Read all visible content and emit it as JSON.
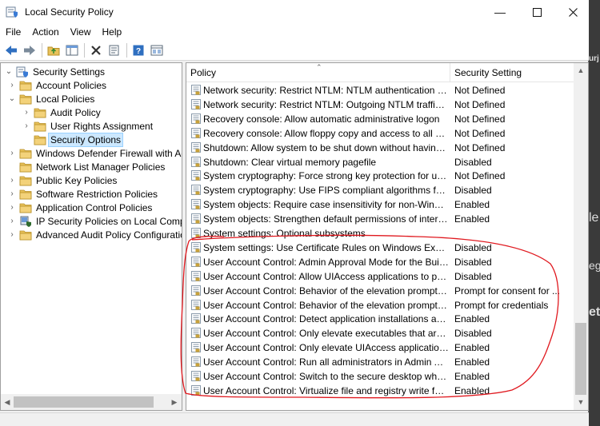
{
  "window": {
    "title": "Local Security Policy"
  },
  "menu": [
    "File",
    "Action",
    "View",
    "Help"
  ],
  "toolbar": [
    "back-icon",
    "forward-icon",
    "up-folder-icon",
    "show-hide-tree-icon",
    "delete-icon",
    "properties-icon",
    "help-icon",
    "console-view-icon"
  ],
  "tree": [
    {
      "label": "Security Settings",
      "level": 0,
      "expander": "open",
      "icon": "security-settings-icon"
    },
    {
      "label": "Account Policies",
      "level": 1,
      "expander": "closed",
      "icon": "folder-icon"
    },
    {
      "label": "Local Policies",
      "level": 1,
      "expander": "open",
      "icon": "folder-icon"
    },
    {
      "label": "Audit Policy",
      "level": 2,
      "expander": "closed",
      "icon": "folder-icon"
    },
    {
      "label": "User Rights Assignment",
      "level": 2,
      "expander": "closed",
      "icon": "folder-icon"
    },
    {
      "label": "Security Options",
      "level": 2,
      "expander": "none",
      "icon": "folder-icon",
      "selected": true
    },
    {
      "label": "Windows Defender Firewall with Adva",
      "level": 1,
      "expander": "closed",
      "icon": "folder-icon"
    },
    {
      "label": "Network List Manager Policies",
      "level": 1,
      "expander": "none",
      "icon": "folder-icon"
    },
    {
      "label": "Public Key Policies",
      "level": 1,
      "expander": "closed",
      "icon": "folder-icon"
    },
    {
      "label": "Software Restriction Policies",
      "level": 1,
      "expander": "closed",
      "icon": "folder-icon"
    },
    {
      "label": "Application Control Policies",
      "level": 1,
      "expander": "closed",
      "icon": "folder-icon"
    },
    {
      "label": "IP Security Policies on Local Compute",
      "level": 1,
      "expander": "closed",
      "icon": "ip-security-icon"
    },
    {
      "label": "Advanced Audit Policy Configuration",
      "level": 1,
      "expander": "closed",
      "icon": "folder-icon"
    }
  ],
  "columns": {
    "policy": "Policy",
    "setting": "Security Setting"
  },
  "policies": [
    {
      "name": "Network security: Restrict NTLM: NTLM authentication in thi...",
      "setting": "Not Defined"
    },
    {
      "name": "Network security: Restrict NTLM: Outgoing NTLM traffic to r...",
      "setting": "Not Defined"
    },
    {
      "name": "Recovery console: Allow automatic administrative logon",
      "setting": "Not Defined"
    },
    {
      "name": "Recovery console: Allow floppy copy and access to all drives...",
      "setting": "Not Defined"
    },
    {
      "name": "Shutdown: Allow system to be shut down without having to...",
      "setting": "Not Defined"
    },
    {
      "name": "Shutdown: Clear virtual memory pagefile",
      "setting": "Disabled"
    },
    {
      "name": "System cryptography: Force strong key protection for user k...",
      "setting": "Not Defined"
    },
    {
      "name": "System cryptography: Use FIPS compliant algorithms for en...",
      "setting": "Disabled"
    },
    {
      "name": "System objects: Require case insensitivity for non-Windows ...",
      "setting": "Enabled"
    },
    {
      "name": "System objects: Strengthen default permissions of internal s...",
      "setting": "Enabled"
    },
    {
      "name": "System settings: Optional subsystems",
      "setting": ""
    },
    {
      "name": "System settings: Use Certificate Rules on Windows Executab...",
      "setting": "Disabled"
    },
    {
      "name": "User Account Control: Admin Approval Mode for the Built-i...",
      "setting": "Disabled"
    },
    {
      "name": "User Account Control: Allow UIAccess applications to prom...",
      "setting": "Disabled"
    },
    {
      "name": "User Account Control: Behavior of the elevation prompt for ...",
      "setting": "Prompt for consent for ..."
    },
    {
      "name": "User Account Control: Behavior of the elevation prompt for ...",
      "setting": "Prompt for credentials"
    },
    {
      "name": "User Account Control: Detect application installations and p...",
      "setting": "Enabled"
    },
    {
      "name": "User Account Control: Only elevate executables that are sig...",
      "setting": "Disabled"
    },
    {
      "name": "User Account Control: Only elevate UIAccess applications th...",
      "setting": "Enabled"
    },
    {
      "name": "User Account Control: Run all administrators in Admin Appr...",
      "setting": "Enabled"
    },
    {
      "name": "User Account Control: Switch to the secure desktop when pr...",
      "setting": "Enabled"
    },
    {
      "name": "User Account Control: Virtualize file and registry write failure...",
      "setting": "Enabled"
    }
  ],
  "background_text": [
    "urj",
    "le",
    "eg",
    "etc"
  ],
  "colors": {
    "selection": "#cce8ff",
    "annotation": "#e0191f",
    "folder": "#e8c15a"
  }
}
